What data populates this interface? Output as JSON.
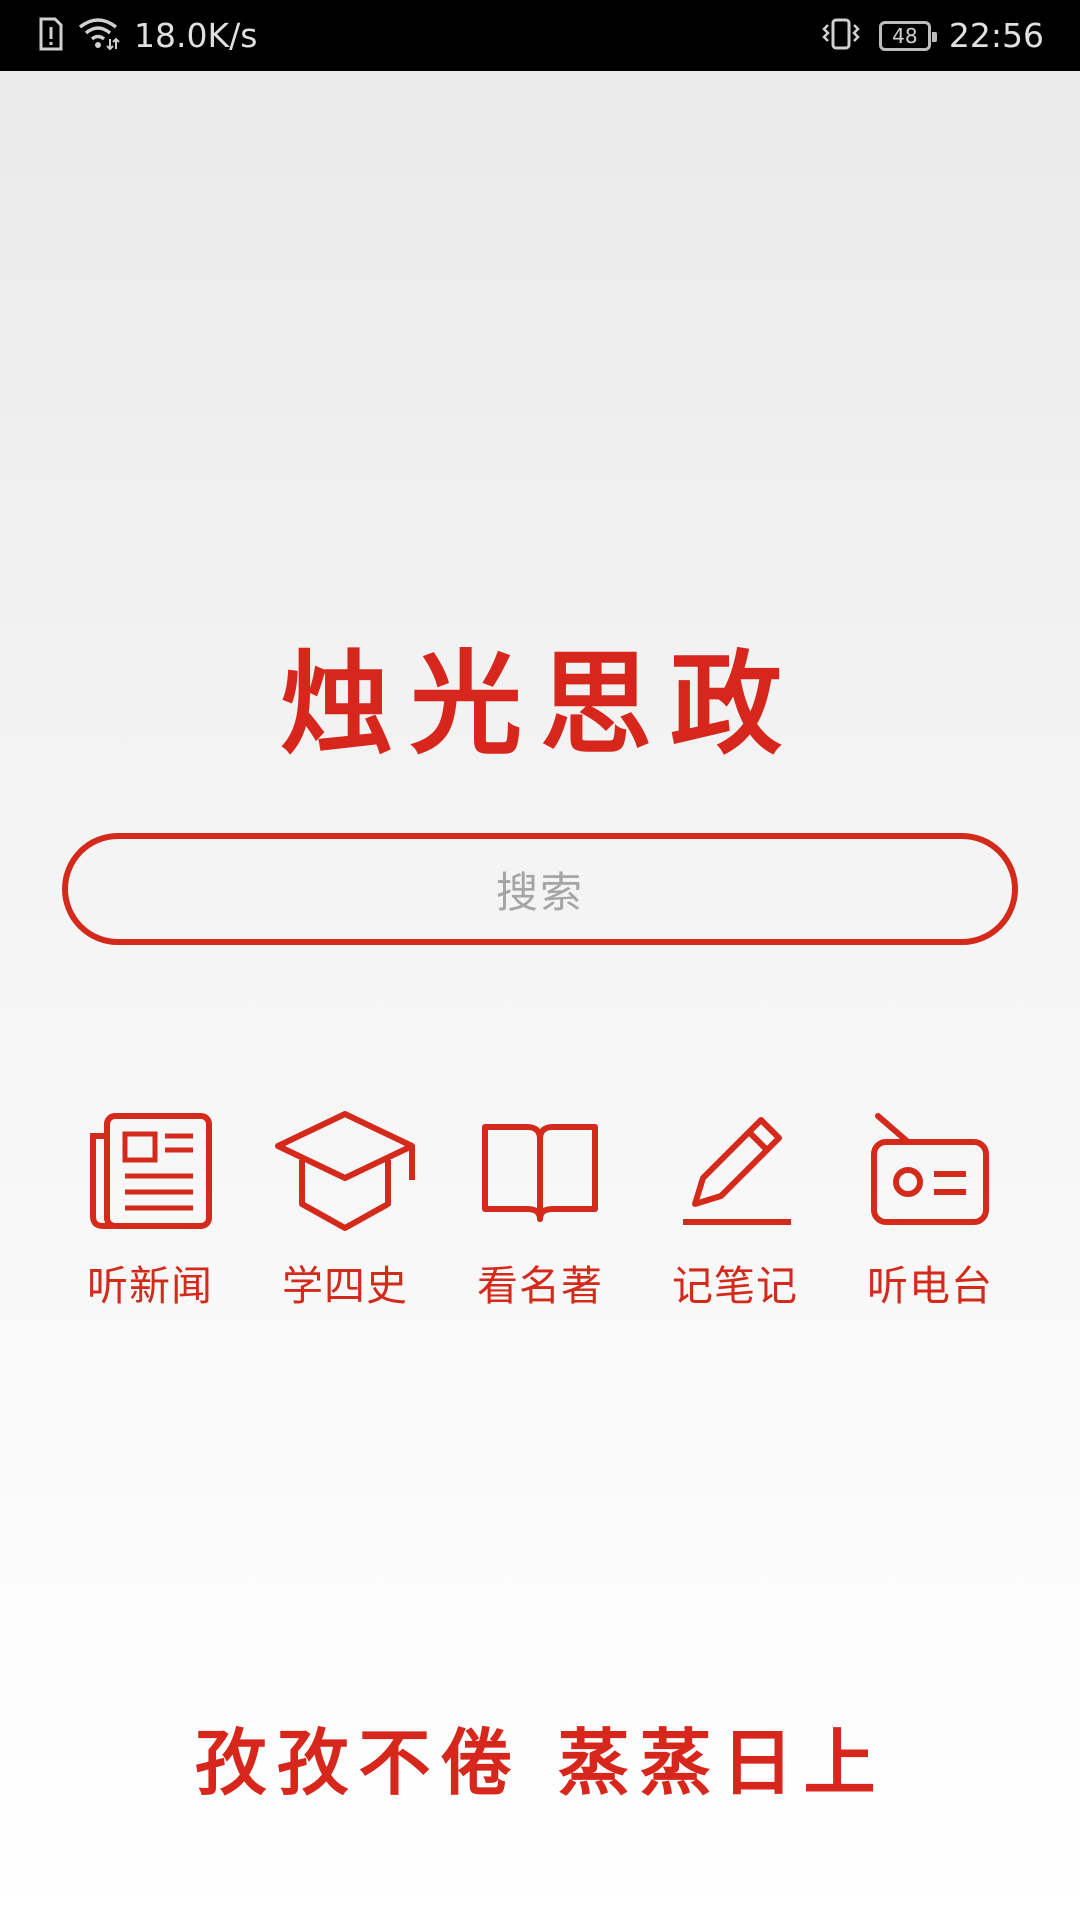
{
  "status_bar": {
    "network_speed": "18.0K/s",
    "battery_level": "48",
    "time": "22:56",
    "icons": [
      "sim-alert-icon",
      "wifi-icon",
      "vibrate-icon",
      "battery-icon"
    ]
  },
  "app": {
    "title": "烛光思政",
    "slogan": "孜孜不倦 蒸蒸日上"
  },
  "search": {
    "placeholder": "搜索"
  },
  "nav": {
    "items": [
      {
        "label": "听新闻",
        "icon": "newspaper-icon"
      },
      {
        "label": "学四史",
        "icon": "graduation-cap-icon"
      },
      {
        "label": "看名著",
        "icon": "open-book-icon"
      },
      {
        "label": "记笔记",
        "icon": "pencil-icon"
      },
      {
        "label": "听电台",
        "icon": "radio-icon"
      }
    ]
  },
  "colors": {
    "accent": "#d32a1b",
    "placeholder": "#a5a5a5",
    "status_bar": "#000000"
  }
}
